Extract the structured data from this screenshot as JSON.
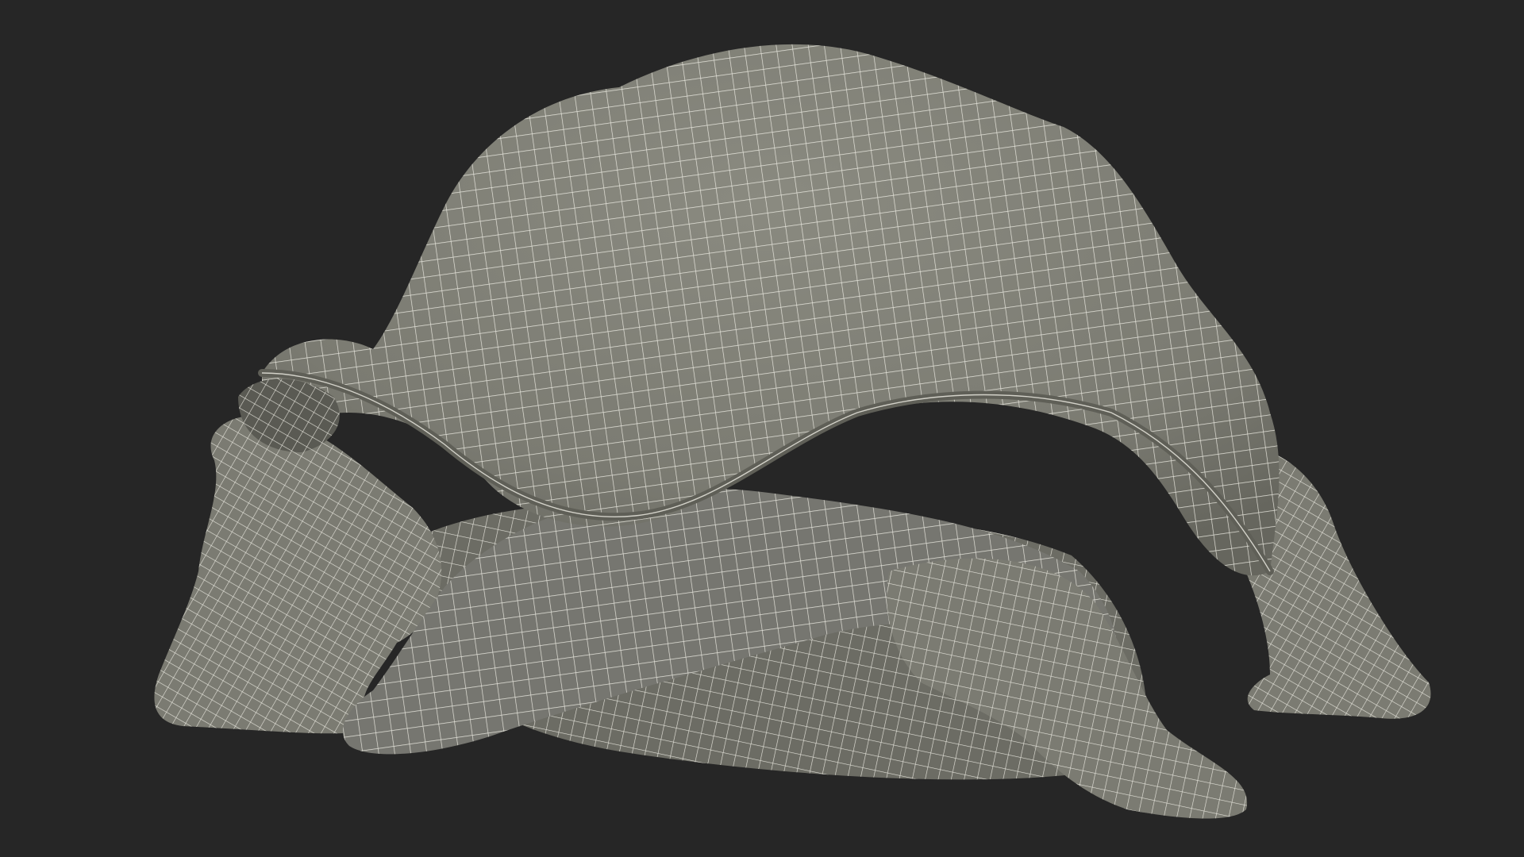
{
  "scene": {
    "subject": "tortoise-wireframe-model",
    "colors": {
      "background": "#262626",
      "surface": "#7b7b72",
      "surface_shadow": "#5f5f57",
      "surface_light": "#8a8a80",
      "wire": "#f0efe6"
    }
  }
}
